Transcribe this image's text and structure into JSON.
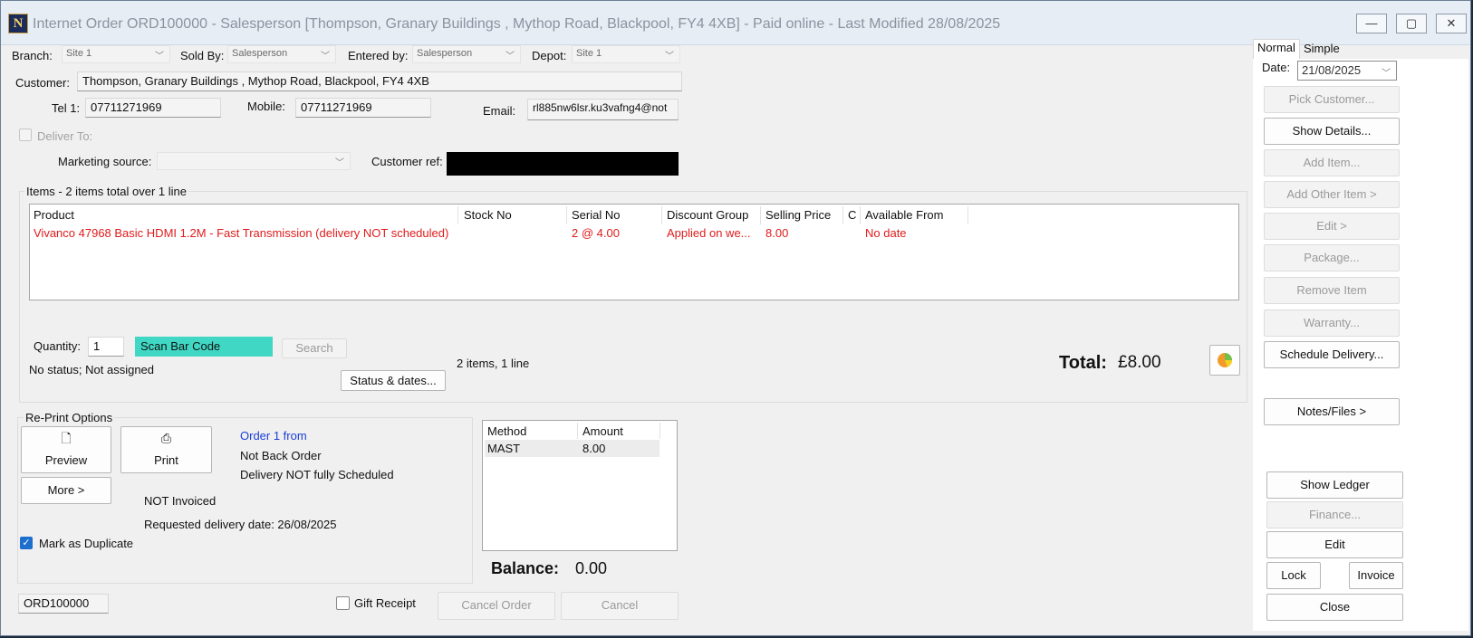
{
  "window": {
    "title": "Internet Order ORD100000 - Salesperson [Thompson, Granary Buildings , Mythop Road, Blackpool, FY4 4XB] - Paid online - Last Modified 28/08/2025",
    "app_icon_glyph": "N",
    "controls": {
      "minimize": "—",
      "restore": "▢",
      "close": "✕"
    }
  },
  "header": {
    "branch_label": "Branch:",
    "branch_value": "Site 1",
    "sold_by_label": "Sold By:",
    "sold_by_value": "Salesperson",
    "entered_by_label": "Entered by:",
    "entered_by_value": "Salesperson",
    "depot_label": "Depot:",
    "depot_value": "Site 1"
  },
  "customer": {
    "label": "Customer:",
    "value": "Thompson, Granary Buildings , Mythop Road, Blackpool, FY4 4XB",
    "tel_label": "Tel 1:",
    "tel_value": "07711271969",
    "mobile_label": "Mobile:",
    "mobile_value": "07711271969",
    "email_label": "Email:",
    "email_value": "rl885nw6lsr.ku3vafng4@not",
    "deliver_to_label": "Deliver To:",
    "marketing_label": "Marketing source:",
    "marketing_value": "",
    "ref_label": "Customer ref:"
  },
  "items": {
    "group_label": "Items - 2 items total over 1 line",
    "columns": [
      "Product",
      "Stock No",
      "Serial No",
      "Discount Group",
      "Selling Price",
      "C",
      "Available From"
    ],
    "rows": [
      [
        "Vivanco 47968 Basic HDMI 1.2M - Fast Transmission (delivery NOT scheduled)",
        "",
        "2 @ 4.00",
        "Applied on we...",
        "8.00",
        "",
        "No date"
      ]
    ],
    "quantity_label": "Quantity:",
    "quantity_value": "1",
    "scan_value": "Scan Bar Code",
    "search_label": "Search",
    "status_text": "No status; Not assigned",
    "status_button": "Status & dates...",
    "count_text": "2 items, 1 line",
    "total_label": "Total:",
    "total_value": "£8.00"
  },
  "reprint": {
    "group_label": "Re-Print Options",
    "preview_label": "Preview",
    "print_label": "Print",
    "more_label": "More >",
    "order_link": "Order 1 from",
    "back_order": "Not Back Order",
    "delivery_status": "Delivery NOT fully Scheduled",
    "invoiced": "NOT Invoiced",
    "requested_date": "Requested delivery date: 26/08/2025",
    "duplicate_label": "Mark as Duplicate"
  },
  "payments": {
    "columns": [
      "Method",
      "Amount"
    ],
    "rows": [
      [
        "MAST",
        "8.00"
      ]
    ],
    "balance_label": "Balance:",
    "balance_value": "0.00"
  },
  "footer": {
    "order_number": "ORD100000",
    "gift_receipt_label": "Gift Receipt",
    "cancel_order_label": "Cancel Order",
    "cancel_label": "Cancel"
  },
  "sidebar": {
    "tab_normal": "Normal",
    "tab_simple": "Simple",
    "date_label": "Date:",
    "date_value": "21/08/2025",
    "pick_customer": "Pick Customer...",
    "show_details": "Show Details...",
    "add_item": "Add Item...",
    "add_other_item": "Add Other Item >",
    "edit_arrow": "Edit >",
    "package": "Package...",
    "remove_item": "Remove Item",
    "warranty": "Warranty...",
    "schedule_delivery": "Schedule Delivery...",
    "notes_files": "Notes/Files >",
    "show_ledger": "Show Ledger",
    "finance": "Finance...",
    "edit": "Edit",
    "lock": "Lock",
    "invoice": "Invoice",
    "close": "Close"
  },
  "colors": {
    "accent_red": "#e01b1b",
    "link_blue": "#1a3ed6",
    "scan_bg": "#40d8c4"
  }
}
